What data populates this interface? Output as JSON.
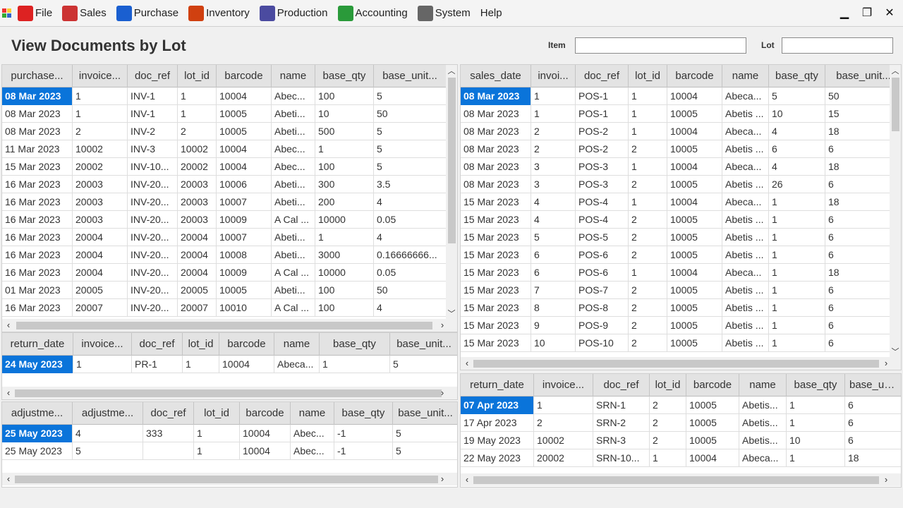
{
  "menubar": {
    "items": [
      {
        "label": "File",
        "icon": "file-icon",
        "color": "#d22"
      },
      {
        "label": "Sales",
        "icon": "cart-icon",
        "color": "#c33"
      },
      {
        "label": "Purchase",
        "icon": "purchase-icon",
        "color": "#1a5fd0"
      },
      {
        "label": "Inventory",
        "icon": "inventory-icon",
        "color": "#d04010"
      },
      {
        "label": "Production",
        "icon": "production-icon",
        "color": "#4b4ba0"
      },
      {
        "label": "Accounting",
        "icon": "accounting-icon",
        "color": "#2a9a3a"
      },
      {
        "label": "System",
        "icon": "system-icon",
        "color": "#666"
      },
      {
        "label": "Help",
        "icon": "",
        "color": ""
      }
    ],
    "window_controls": {
      "minimize": "▁",
      "restore": "❐",
      "close": "✕"
    }
  },
  "header": {
    "title": "View Documents by Lot",
    "item_label": "Item",
    "item_value": "",
    "lot_label": "Lot",
    "lot_value": ""
  },
  "purchases": {
    "columns": [
      "purchase...",
      "invoice...",
      "doc_ref",
      "lot_id",
      "barcode",
      "name",
      "base_qty",
      "base_unit..."
    ],
    "rows": [
      [
        "08 Mar 2023",
        "1",
        "INV-1",
        "1",
        "10004",
        "Abec...",
        "100",
        "5"
      ],
      [
        "08 Mar 2023",
        "1",
        "INV-1",
        "1",
        "10005",
        "Abeti...",
        "10",
        "50"
      ],
      [
        "08 Mar 2023",
        "2",
        "INV-2",
        "2",
        "10005",
        "Abeti...",
        "500",
        "5"
      ],
      [
        "11 Mar 2023",
        "10002",
        "INV-3",
        "10002",
        "10004",
        "Abec...",
        "1",
        "5"
      ],
      [
        "15 Mar 2023",
        "20002",
        "INV-10...",
        "20002",
        "10004",
        "Abec...",
        "100",
        "5"
      ],
      [
        "16 Mar 2023",
        "20003",
        "INV-20...",
        "20003",
        "10006",
        "Abeti...",
        "300",
        "3.5"
      ],
      [
        "16 Mar 2023",
        "20003",
        "INV-20...",
        "20003",
        "10007",
        "Abeti...",
        "200",
        "4"
      ],
      [
        "16 Mar 2023",
        "20003",
        "INV-20...",
        "20003",
        "10009",
        "A Cal ...",
        "10000",
        "0.05"
      ],
      [
        "16 Mar 2023",
        "20004",
        "INV-20...",
        "20004",
        "10007",
        "Abeti...",
        "1",
        "4"
      ],
      [
        "16 Mar 2023",
        "20004",
        "INV-20...",
        "20004",
        "10008",
        "Abeti...",
        "3000",
        "0.16666666..."
      ],
      [
        "16 Mar 2023",
        "20004",
        "INV-20...",
        "20004",
        "10009",
        "A Cal ...",
        "10000",
        "0.05"
      ],
      [
        "01 Mar 2023",
        "20005",
        "INV-20...",
        "20005",
        "10005",
        "Abeti...",
        "100",
        "50"
      ],
      [
        "16 Mar 2023",
        "20007",
        "INV-20...",
        "20007",
        "10010",
        "A Cal ...",
        "100",
        "4"
      ]
    ]
  },
  "purchase_returns": {
    "columns": [
      "return_date",
      "invoice...",
      "doc_ref",
      "lot_id",
      "barcode",
      "name",
      "base_qty",
      "base_unit..."
    ],
    "rows": [
      [
        "24 May 2023",
        "1",
        "PR-1",
        "1",
        "10004",
        "Abeca...",
        "1",
        "5"
      ]
    ]
  },
  "adjustments": {
    "columns": [
      "adjustme...",
      "adjustme...",
      "doc_ref",
      "lot_id",
      "barcode",
      "name",
      "base_qty",
      "base_unit..."
    ],
    "rows": [
      [
        "25 May 2023",
        "4",
        "333",
        "1",
        "10004",
        "Abec...",
        "-1",
        "5"
      ],
      [
        "25 May 2023",
        "5",
        "",
        "1",
        "10004",
        "Abec...",
        "-1",
        "5"
      ]
    ]
  },
  "sales": {
    "columns": [
      "sales_date",
      "invoi...",
      "doc_ref",
      "lot_id",
      "barcode",
      "name",
      "base_qty",
      "base_unit..."
    ],
    "rows": [
      [
        "08 Mar 2023",
        "1",
        "POS-1",
        "1",
        "10004",
        "Abeca...",
        "5",
        "50"
      ],
      [
        "08 Mar 2023",
        "1",
        "POS-1",
        "1",
        "10005",
        "Abetis ...",
        "10",
        "15"
      ],
      [
        "08 Mar 2023",
        "2",
        "POS-2",
        "1",
        "10004",
        "Abeca...",
        "4",
        "18"
      ],
      [
        "08 Mar 2023",
        "2",
        "POS-2",
        "2",
        "10005",
        "Abetis ...",
        "6",
        "6"
      ],
      [
        "08 Mar 2023",
        "3",
        "POS-3",
        "1",
        "10004",
        "Abeca...",
        "4",
        "18"
      ],
      [
        "08 Mar 2023",
        "3",
        "POS-3",
        "2",
        "10005",
        "Abetis ...",
        "26",
        "6"
      ],
      [
        "15 Mar 2023",
        "4",
        "POS-4",
        "1",
        "10004",
        "Abeca...",
        "1",
        "18"
      ],
      [
        "15 Mar 2023",
        "4",
        "POS-4",
        "2",
        "10005",
        "Abetis ...",
        "1",
        "6"
      ],
      [
        "15 Mar 2023",
        "5",
        "POS-5",
        "2",
        "10005",
        "Abetis ...",
        "1",
        "6"
      ],
      [
        "15 Mar 2023",
        "6",
        "POS-6",
        "2",
        "10005",
        "Abetis ...",
        "1",
        "6"
      ],
      [
        "15 Mar 2023",
        "6",
        "POS-6",
        "1",
        "10004",
        "Abeca...",
        "1",
        "18"
      ],
      [
        "15 Mar 2023",
        "7",
        "POS-7",
        "2",
        "10005",
        "Abetis ...",
        "1",
        "6"
      ],
      [
        "15 Mar 2023",
        "8",
        "POS-8",
        "2",
        "10005",
        "Abetis ...",
        "1",
        "6"
      ],
      [
        "15 Mar 2023",
        "9",
        "POS-9",
        "2",
        "10005",
        "Abetis ...",
        "1",
        "6"
      ],
      [
        "15 Mar 2023",
        "10",
        "POS-10",
        "2",
        "10005",
        "Abetis ...",
        "1",
        "6"
      ]
    ]
  },
  "sales_returns": {
    "columns": [
      "return_date",
      "invoice...",
      "doc_ref",
      "lot_id",
      "barcode",
      "name",
      "base_qty",
      "base_unit..."
    ],
    "rows": [
      [
        "07 Apr 2023",
        "1",
        "SRN-1",
        "2",
        "10005",
        "Abetis...",
        "1",
        "6"
      ],
      [
        "17 Apr 2023",
        "2",
        "SRN-2",
        "2",
        "10005",
        "Abetis...",
        "1",
        "6"
      ],
      [
        "19 May 2023",
        "10002",
        "SRN-3",
        "2",
        "10005",
        "Abetis...",
        "10",
        "6"
      ],
      [
        "22 May 2023",
        "20002",
        "SRN-10...",
        "1",
        "10004",
        "Abeca...",
        "1",
        "18"
      ]
    ]
  },
  "colors": {
    "selection": "#0a74da",
    "header_bg": "#e3e3e3"
  }
}
